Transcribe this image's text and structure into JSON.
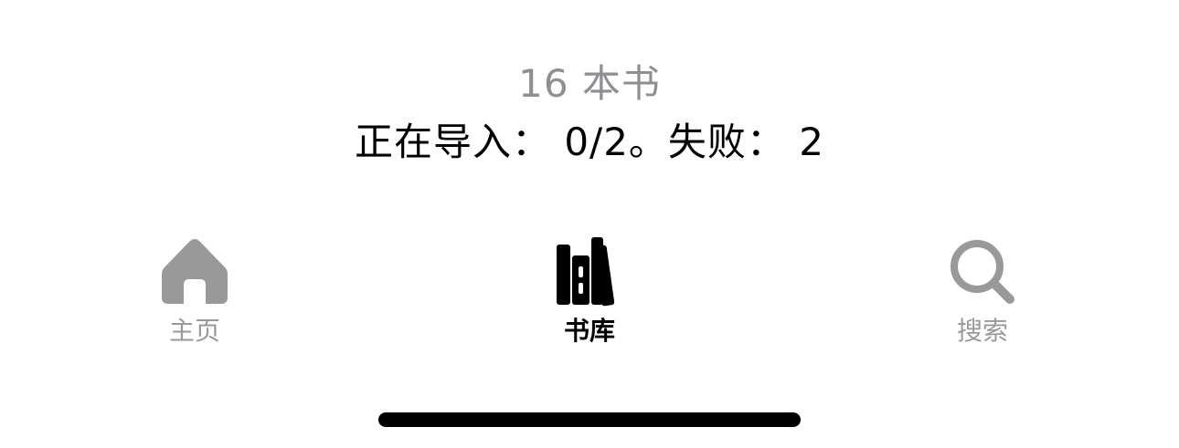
{
  "library_status": {
    "book_count": "16 本书",
    "import_status": "正在导入： 0/2。失败： 2"
  },
  "tab_bar": {
    "active_tab": "library",
    "tabs": [
      {
        "id": "home",
        "label": "主页",
        "icon": "house-icon"
      },
      {
        "id": "library",
        "label": "书库",
        "icon": "books-icon"
      },
      {
        "id": "search",
        "label": "搜索",
        "icon": "magnifying-glass-icon"
      }
    ]
  },
  "colors": {
    "inactive": "#999999",
    "active": "#000000",
    "secondary_text": "#8e8e93"
  }
}
